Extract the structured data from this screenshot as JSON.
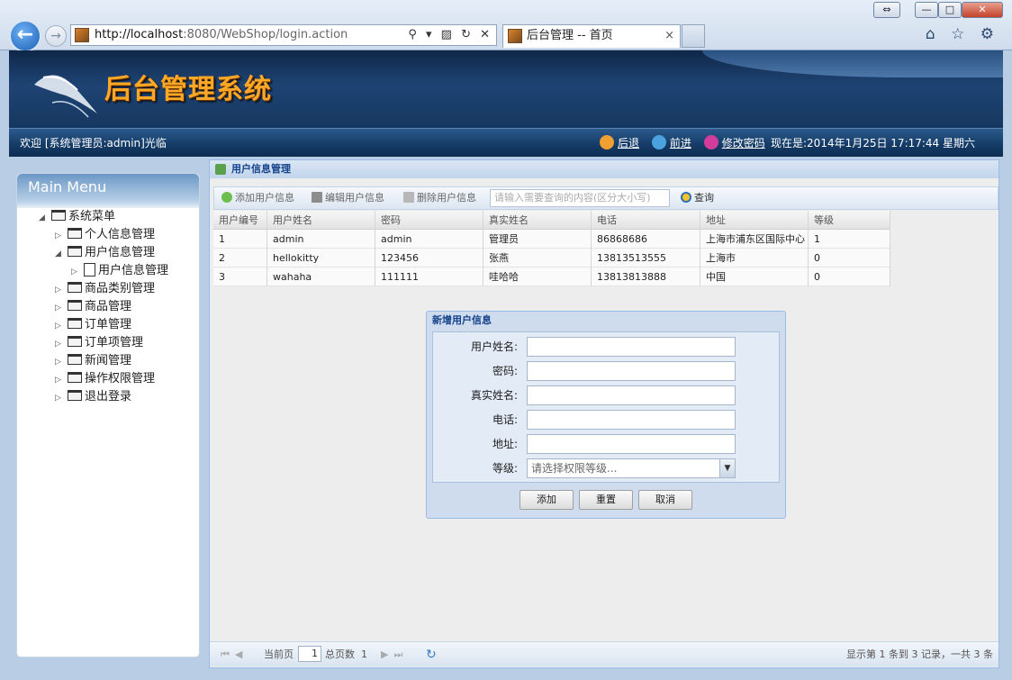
{
  "browser": {
    "url_host": "http://localhost",
    "url_rest": ":8080/WebShop/login.action",
    "address_tools": "⚲ ▾ ▨ ↻ ✕",
    "tab_title": "后台管理 -- 首页",
    "tab_close": "×",
    "window_buttons": {
      "restore_alt": "⇔",
      "minimize": "—",
      "maximize": "□",
      "close": "✕"
    },
    "toolbar_icons": "⌂ ☆ ⚙"
  },
  "header": {
    "site_title": "后台管理系统",
    "welcome": "欢迎 [系统管理员:admin]光临",
    "back_label": "后退",
    "forward_label": "前进",
    "change_pwd_label": "修改密码",
    "now_text": "现在是:2014年1月25日  17:17:44 星期六",
    "colors": {
      "title": "#ffa726",
      "bar": "#143a65"
    }
  },
  "menu": {
    "title": "Main Menu",
    "root": "系统菜单",
    "items": [
      "个人信息管理",
      "用户信息管理",
      "用户信息管理",
      "商品类别管理",
      "商品管理",
      "订单管理",
      "订单项管理",
      "新闻管理",
      "操作权限管理",
      "退出登录"
    ]
  },
  "panel": {
    "title": "用户信息管理",
    "toolbar": {
      "add": "添加用户信息",
      "edit": "编辑用户信息",
      "delete": "删除用户信息",
      "search_placeholder": "请输入需要查询的内容(区分大小写)",
      "search": "查询"
    },
    "grid": {
      "columns": [
        "用户编号",
        "用户姓名",
        "密码",
        "真实姓名",
        "电话",
        "地址",
        "等级"
      ],
      "rows": [
        [
          "1",
          "admin",
          "admin",
          "管理员",
          "86868686",
          "上海市浦东区国际中心",
          "1"
        ],
        [
          "2",
          "hellokitty",
          "123456",
          "张燕",
          "13813513555",
          "上海市",
          "0"
        ],
        [
          "3",
          "wahaha",
          "111111",
          "哇哈哈",
          "13813813888",
          "中国",
          "0"
        ]
      ]
    },
    "pager": {
      "current_label": "当前页",
      "current_page": "1",
      "total_label": "总页数",
      "total_pages": "1",
      "summary": "显示第 1 条到 3 记录，一共 3 条"
    }
  },
  "dialog": {
    "title": "新增用户信息",
    "fields": {
      "username": "用户姓名:",
      "password": "密码:",
      "realname": "真实姓名:",
      "phone": "电话:",
      "address": "地址:",
      "level": "等级:"
    },
    "level_placeholder": "请选择权限等级...",
    "buttons": {
      "add": "添加",
      "reset": "重置",
      "cancel": "取消"
    }
  }
}
